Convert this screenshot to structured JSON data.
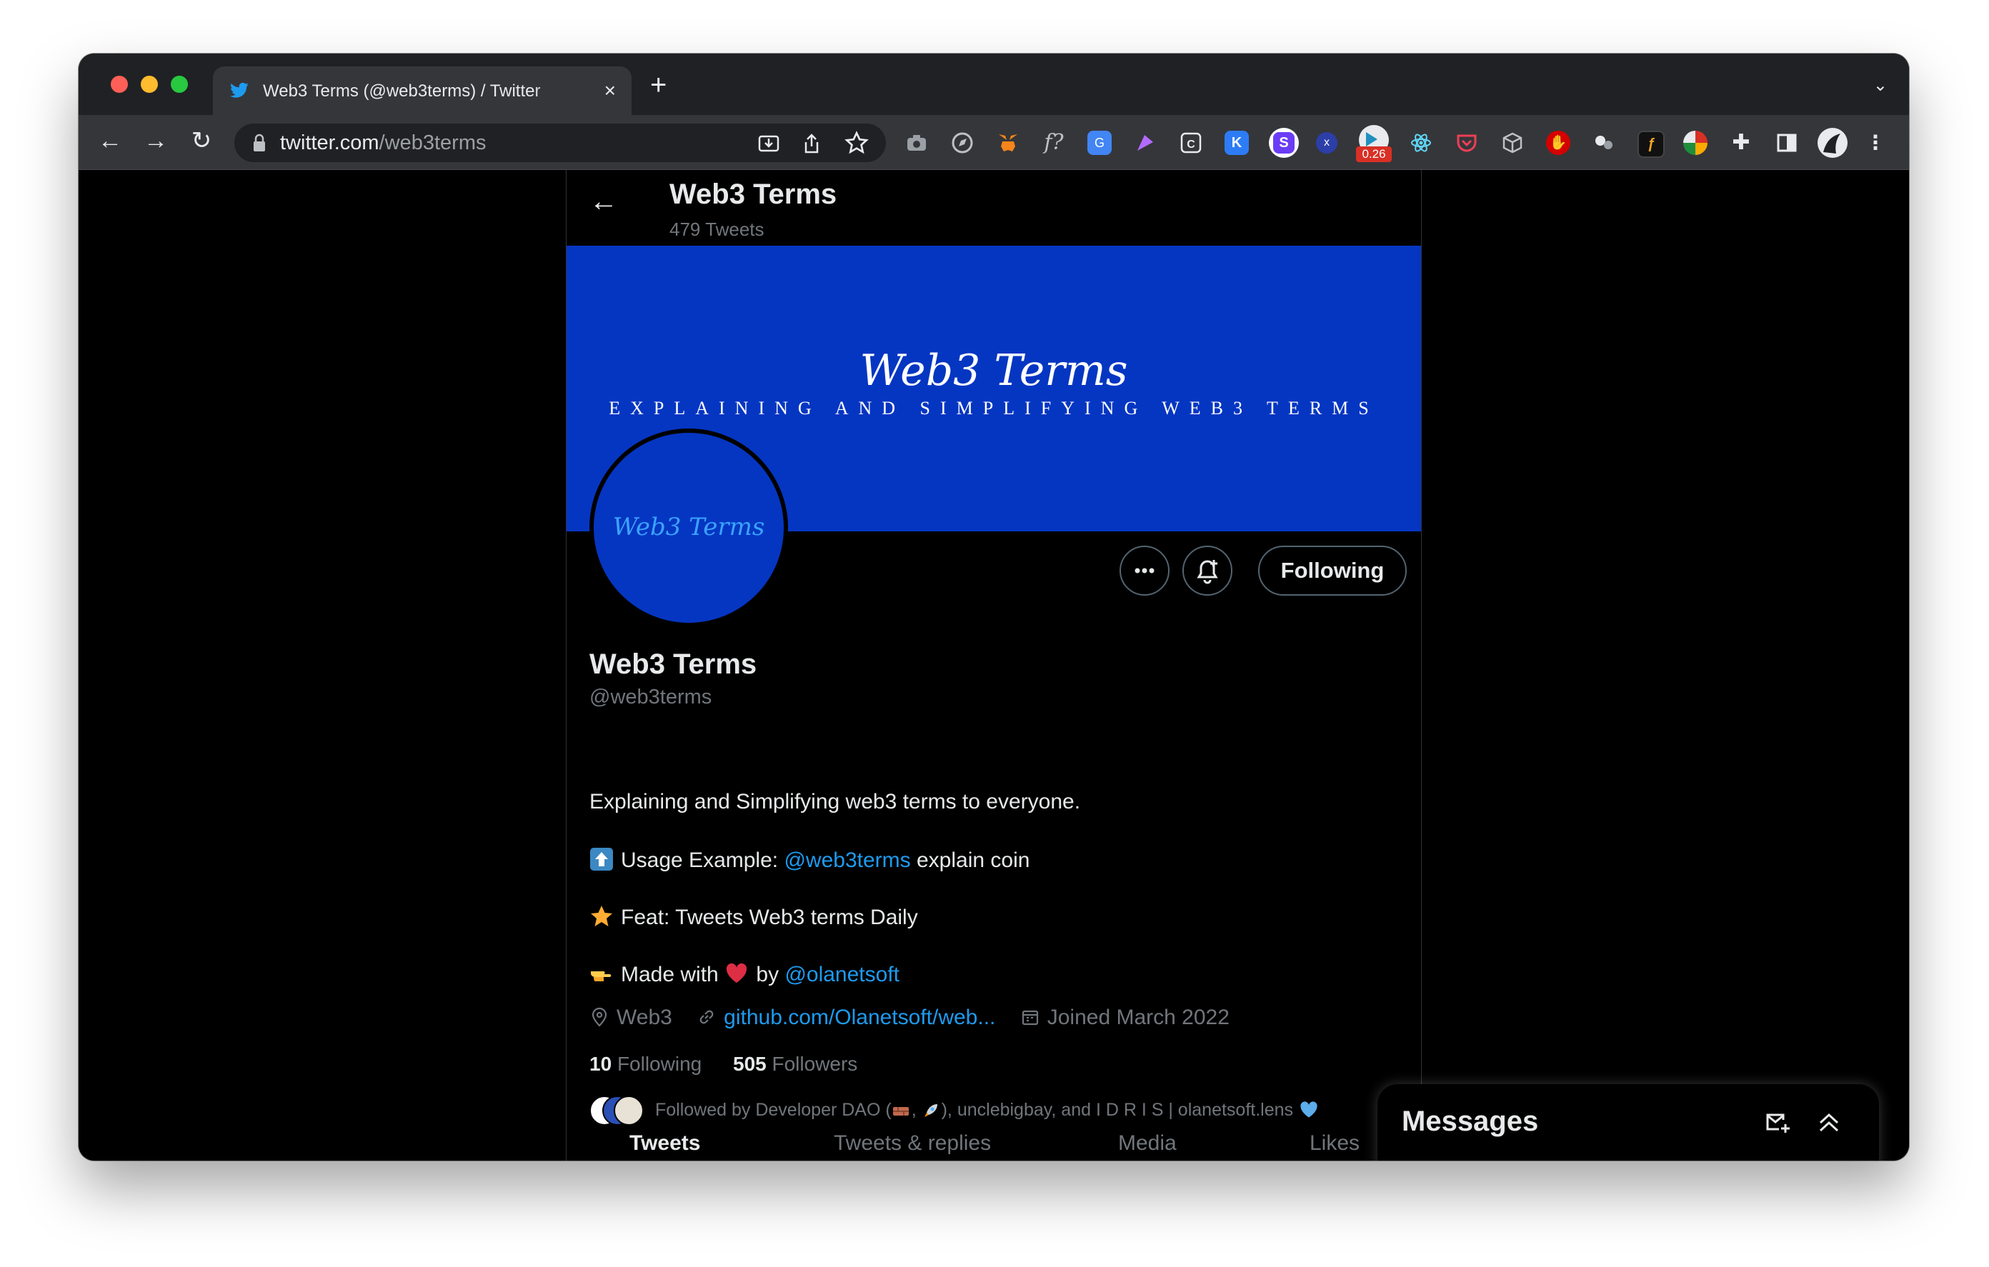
{
  "browser": {
    "tab_title": "Web3 Terms (@web3terms) / Twitter",
    "tab_close": "×",
    "new_tab": "+",
    "tab_menu": "⌄",
    "back": "←",
    "forward": "→",
    "reload": "↻",
    "url_host": "twitter.com",
    "url_path": "/web3terms",
    "counter_badge": "0.26"
  },
  "header": {
    "back_arrow": "←",
    "name": "Web3 Terms",
    "tweet_count": "479 Tweets"
  },
  "banner": {
    "title": "Web3 Terms",
    "subtitle": "EXPLAINING AND SIMPLIFYING WEB3 TERMS",
    "color": "#0536c2"
  },
  "avatar": {
    "text": "Web3 Terms"
  },
  "actions": {
    "more": "•••",
    "following_label": "Following"
  },
  "profile": {
    "name": "Web3 Terms",
    "handle": "@web3terms",
    "bio_line1": "Explaining and Simplifying web3 terms to everyone.",
    "bio_line2_prefix": "Usage Example: ",
    "bio_line2_mention": "@web3terms",
    "bio_line2_suffix": " explain coin",
    "bio_line3": "Feat: Tweets Web3 terms Daily",
    "bio_line4_prefix": "Made with ",
    "bio_line4_middle": " by ",
    "bio_line4_mention": "@olanetsoft",
    "location": "Web3",
    "website": "github.com/Olanetsoft/web...",
    "joined": "Joined March 2022",
    "following_count": "10",
    "following_label": "Following",
    "followers_count": "505",
    "followers_label": "Followers",
    "followed_by_prefix": "Followed by Developer DAO (",
    "followed_by_mid": ", ",
    "followed_by_suffix": "), unclebigbay, and I D R I S | olanetsoft.lens"
  },
  "profile_tabs": [
    "Tweets",
    "Tweets & replies",
    "Media",
    "Likes"
  ],
  "messages": {
    "title": "Messages"
  },
  "colors": {
    "accent": "#1d9bf0",
    "background": "#000000",
    "text": "#e7e9ea",
    "muted": "#71767b"
  }
}
